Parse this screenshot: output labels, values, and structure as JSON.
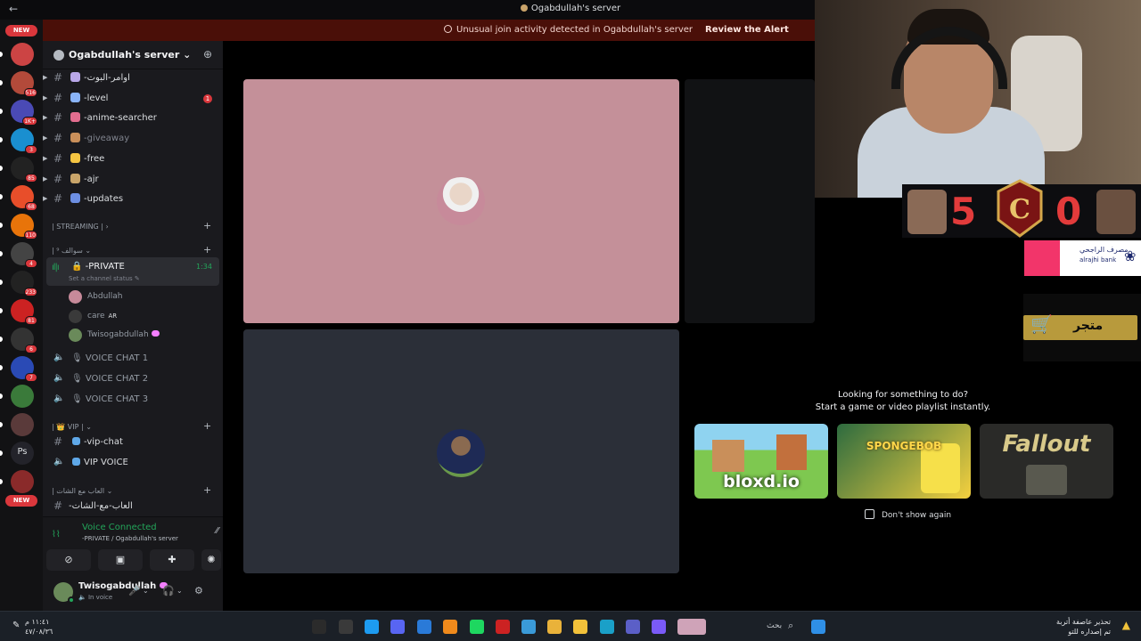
{
  "window": {
    "title": "Ogabdullah's server",
    "back_icon": "arrow-left-icon"
  },
  "alert": {
    "message": "Unusual join activity detected in Ogabdullah's server",
    "action": "Review the Alert"
  },
  "rail": {
    "new_top": "NEW",
    "new_bottom": "NEW",
    "servers": [
      {
        "badge": ""
      },
      {
        "badge": "516"
      },
      {
        "badge": "1K+"
      },
      {
        "badge": "3"
      },
      {
        "badge": "85"
      },
      {
        "badge": "68"
      },
      {
        "badge": "110"
      },
      {
        "badge": "4"
      },
      {
        "badge": "233"
      },
      {
        "badge": "81"
      },
      {
        "badge": "6"
      },
      {
        "badge": "7"
      },
      {
        "badge": ""
      },
      {
        "badge": ""
      },
      {
        "badge": "",
        "label": "Ps"
      },
      {
        "badge": ""
      }
    ]
  },
  "server": {
    "name": "Ogabdullah's server",
    "invite_icon": "add-person-icon"
  },
  "channels": [
    {
      "name": "-اوامر-البوت",
      "emoji_color": "#b9a7e8",
      "dim": false,
      "unread": ""
    },
    {
      "name": "-level",
      "emoji_color": "#8ab4f8",
      "dim": false,
      "unread": "1"
    },
    {
      "name": "-anime-searcher",
      "emoji_color": "#e36d8f",
      "dim": false,
      "unread": ""
    },
    {
      "name": "-giveaway",
      "emoji_color": "#c98f5a",
      "dim": true,
      "unread": ""
    },
    {
      "name": "-free",
      "emoji_color": "#f5c542",
      "dim": false,
      "unread": ""
    },
    {
      "name": "-ajr",
      "emoji_color": "#c9a56a",
      "dim": false,
      "unread": ""
    },
    {
      "name": "-updates",
      "emoji_color": "#6d8fe3",
      "dim": false,
      "unread": ""
    }
  ],
  "categories": {
    "streaming": "STREAMING |",
    "sawalif": "| ⁹ سوالف",
    "vip": "VIP |",
    "games": "| العاب مع الشات"
  },
  "private_voice": {
    "name": "-PRIVATE",
    "time": "1:34",
    "status": "Set a channel status"
  },
  "voice_users": [
    {
      "name": "Abdullah",
      "tag": "",
      "heart": false,
      "color": "#c78a9a"
    },
    {
      "name": "care",
      "tag": "AR",
      "heart": false,
      "color": "#3a3a3a"
    },
    {
      "name": "Twisogabdullah",
      "tag": "",
      "heart": true,
      "color": "#6a8a5a"
    }
  ],
  "voice_channels": [
    "VOICE CHAT 1",
    "VOICE CHAT 2",
    "VOICE CHAT 3"
  ],
  "vip_channels": {
    "text": "-vip-chat",
    "voice": "VIP VOICE"
  },
  "games_channel": "-العاب-مع-الشات",
  "voice_panel": {
    "status": "Voice Connected",
    "location": "-PRIVATE / Ogabdullah's server"
  },
  "user": {
    "name": "Twisogabdullah",
    "status": "In voice"
  },
  "activity": {
    "line1": "Looking for something to do?",
    "line2": "Start a game or video playlist instantly.",
    "games": [
      {
        "name": "bloxd.io",
        "bg": "#7ec850"
      },
      {
        "name": "SPONGEBOB",
        "bg": "#2d6b3f"
      },
      {
        "name": "Fallout",
        "bg": "#2a2a28"
      }
    ],
    "dont_show": "Don't show again"
  },
  "overlay": {
    "score_left": "5",
    "score_right": "0",
    "bank_ar": "مصرف الراجحي",
    "bank_en": "alrajhi bank",
    "store": "متجر"
  },
  "taskbar": {
    "search": "بحث",
    "time": "١١:٤١ م",
    "date": "٤٧/٠٨/٣٦",
    "notice_1": "تحذير عاصفة أتربة",
    "notice_2": "تم إصداره للتو"
  }
}
